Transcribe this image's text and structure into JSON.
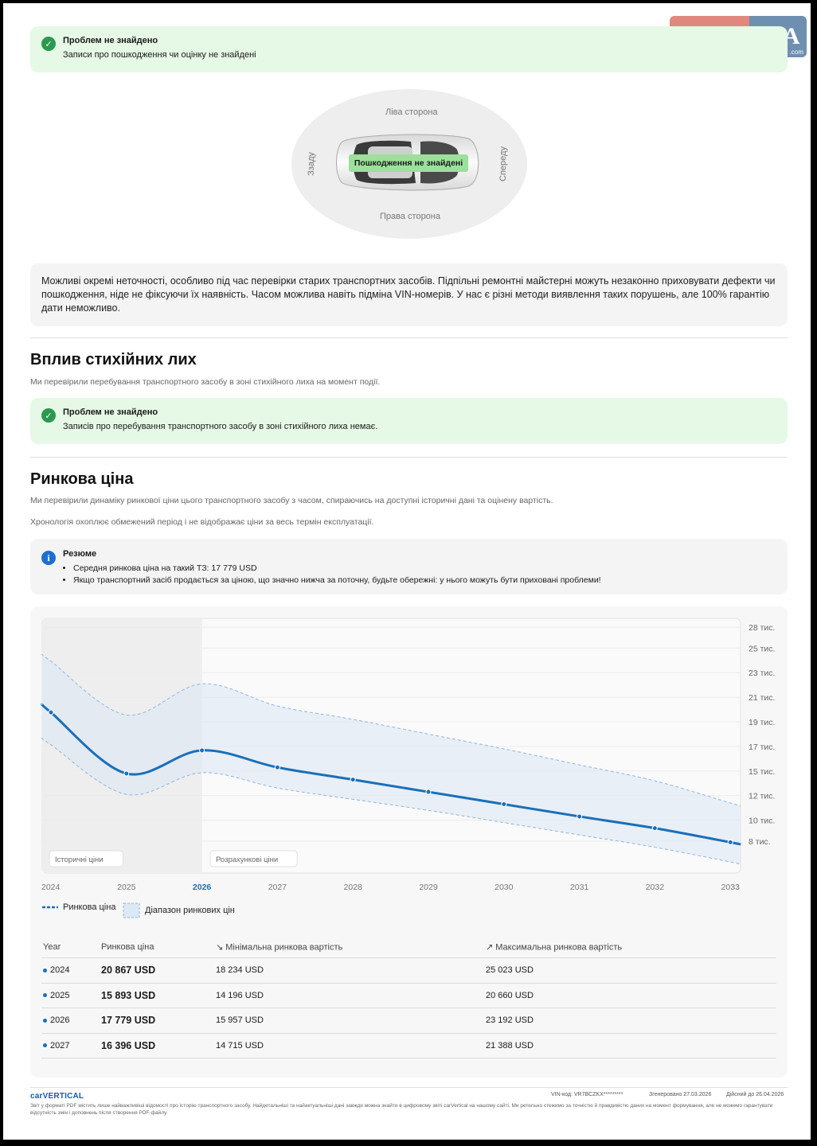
{
  "logo": {
    "auto": "auto",
    "ria": "RIA",
    "com": ".com"
  },
  "damage_alert": {
    "title": "Проблем не знайдено",
    "desc": "Записи про пошкодження чи оцінку не знайдені"
  },
  "car_diagram": {
    "left_side": "Ліва сторона",
    "right_side": "Права сторона",
    "rear": "Ззаду",
    "front": "Спереду",
    "badge": "Пошкодження не знайдені"
  },
  "disclaimer": "Можливі окремі неточності, особливо під час перевірки старих транспортних засобів. Підпільні ремонтні майстерні можуть незаконно приховувати дефекти чи пошкодження, ніде не фіксуючи їх наявність. Часом можлива навіть підміна VIN-номерів. У нас є різні методи виявлення таких порушень, але 100% гарантію дати неможливо.",
  "disaster": {
    "heading": "Вплив стихійних лих",
    "sub": "Ми перевірили перебування транспортного засобу в зоні стихійного лиха на момент події.",
    "alert_title": "Проблем не знайдено",
    "alert_desc": "Записів про перебування транспортного засобу в зоні стихійного лиха немає."
  },
  "market": {
    "heading": "Ринкова ціна",
    "sub1": "Ми перевірили динаміку ринкової ціни цього транспортного засобу з часом, спираючись на доступні історичні дані та оцінену вартість.",
    "sub2": "Хронологія охоплює обмежений період і не відображає ціни за весь термін експлуатації.",
    "resume_title": "Резюме",
    "resume_items": [
      "Середня ринкова ціна на такий ТЗ: 17 779 USD",
      "Якщо транспортний засіб продається за ціною, що значно нижча за поточну, будьте обережні: у нього можуть бути приховані проблеми!"
    ]
  },
  "chart_data": {
    "type": "line",
    "x": [
      2024,
      2025,
      2026,
      2027,
      2028,
      2029,
      2030,
      2031,
      2032,
      2033
    ],
    "x_labels": [
      "2024",
      "2025",
      "2026",
      "2027",
      "2028",
      "2029",
      "2030",
      "2031",
      "2032",
      "2033"
    ],
    "highlight_x": "2026",
    "series": [
      {
        "name": "Ринкова ціна",
        "values": [
          20867,
          15893,
          17779,
          16396,
          15400,
          14400,
          13400,
          12400,
          11450,
          10300
        ]
      },
      {
        "name": "Діапазон ринкових цін",
        "min": [
          18234,
          14196,
          15957,
          14715,
          13800,
          12900,
          11900,
          10900,
          9900,
          8700
        ],
        "max": [
          25023,
          20660,
          23192,
          21388,
          20300,
          19100,
          17900,
          16600,
          15300,
          13500
        ]
      }
    ],
    "y_tick_labels": [
      "28 тис.",
      "25 тис.",
      "23 тис.",
      "21 тис.",
      "19 тис.",
      "17 тис.",
      "15 тис.",
      "12 тис.",
      "10 тис.",
      "8 тис."
    ],
    "y_tick_values": [
      27800,
      26100,
      24100,
      22100,
      20100,
      18100,
      16100,
      14100,
      12100,
      10400
    ],
    "ylim": [
      7800,
      28000
    ],
    "regions": [
      "Історичні ціни",
      "Розрахункові ціни"
    ],
    "legend": [
      "Ринкова ціна",
      "Діапазон ринкових цін"
    ],
    "grid": true,
    "colors": {
      "line": "#1a6fb8",
      "band": "#dce8f5",
      "band_edge": "#8fb6de",
      "history_bg": "#eeeeee"
    }
  },
  "table": {
    "headers": [
      "Year",
      "Ринкова ціна",
      "↘ Мінімальна ринкова вартість",
      "↗ Максимальна ринкова вартість"
    ],
    "rows": [
      {
        "year": "2024",
        "price": "20 867 USD",
        "min": "18 234 USD",
        "max": "25 023 USD"
      },
      {
        "year": "2025",
        "price": "15 893 USD",
        "min": "14 196 USD",
        "max": "20 660 USD"
      },
      {
        "year": "2026",
        "price": "17 779 USD",
        "min": "15 957 USD",
        "max": "23 192 USD"
      },
      {
        "year": "2027",
        "price": "16 396 USD",
        "min": "14 715 USD",
        "max": "21 388 USD"
      }
    ]
  },
  "footer": {
    "brand": "carVERTICAL",
    "vin": "VIN-код: VR7BCZKX*********",
    "generated": "Згенеровано 27.03.2026",
    "valid": "Дійсний до 26.04.2026",
    "fine": "Звіт у форматі PDF містить лише найважливіші відомості про історію транспортного засобу. Найдетальніші та найактуальніші дані завжди можна знайти в цифровому звіті carVertical на нашому сайті. Ми ретельно стежимо за точністю й правдивістю даних на момент формування, але не можемо гарантувати відсутність змін і доповнень після створення PDF-файлу."
  }
}
